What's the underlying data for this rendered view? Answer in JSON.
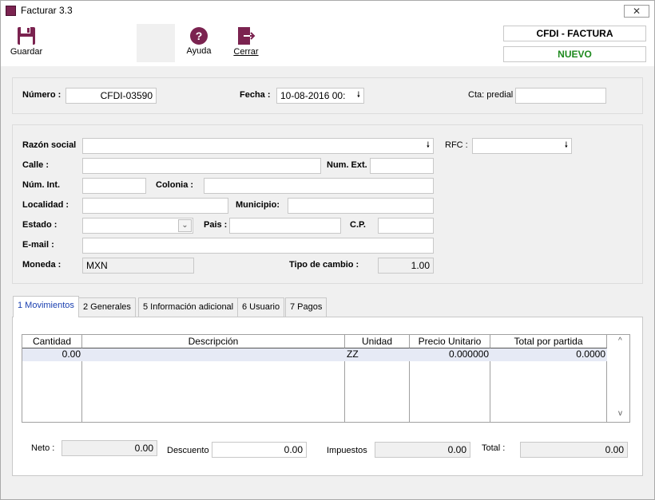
{
  "window": {
    "title": "Facturar 3.3",
    "close_glyph": "✕"
  },
  "toolbar": {
    "guardar_label": "Guardar",
    "ayuda_label": "Ayuda",
    "cerrar_label": "Cerrar",
    "ayuda_glyph": "?",
    "doc_type": "CFDI - FACTURA",
    "status": "NUEVO",
    "status_color": "#1e8a1e"
  },
  "header": {
    "numero_label": "Número :",
    "numero_value": "CFDI-03590",
    "fecha_label": "Fecha :",
    "fecha_value": "10-08-2016 00:",
    "cta_label": "Cta: predial :",
    "cta_value": ""
  },
  "cliente": {
    "razon_label": "Razón social",
    "razon_value": "",
    "rfc_label": "RFC :",
    "rfc_value": "",
    "calle_label": "Calle :",
    "calle_value": "",
    "numext_label": "Num. Ext.",
    "numext_value": "",
    "numint_label": "Núm. Int.",
    "numint_value": "",
    "colonia_label": "Colonia :",
    "colonia_value": "",
    "localidad_label": "Localidad :",
    "localidad_value": "",
    "municipio_label": "Municipio:",
    "municipio_value": "",
    "estado_label": "Estado :",
    "estado_value": "",
    "pais_label": "Pais :",
    "pais_value": "",
    "cp_label": "C.P.",
    "cp_value": "",
    "email_label": "E-mail :",
    "email_value": "",
    "moneda_label": "Moneda :",
    "moneda_value": "MXN",
    "tipocambio_label": "Tipo de cambio :",
    "tipocambio_value": "1.00"
  },
  "tabs": [
    {
      "label": "1 Movimientos"
    },
    {
      "label": "2 Generales"
    },
    {
      "label": "5 Información adicional"
    },
    {
      "label": "6 Usuario"
    },
    {
      "label": "7 Pagos"
    }
  ],
  "grid": {
    "columns": [
      "Cantidad",
      "Descripción",
      "Unidad",
      "Precio Unitario",
      "Total por partida"
    ],
    "rows": [
      {
        "cantidad": "0.00",
        "descripcion": "",
        "unidad": "ZZ",
        "precio": "0.000000",
        "total": "0.0000"
      }
    ]
  },
  "totals": {
    "neto_label": "Neto :",
    "neto_value": "0.00",
    "descuento_label": "Descuento",
    "descuento_value": "0.00",
    "impuestos_label": "Impuestos",
    "impuestos_value": "0.00",
    "total_label": "Total :",
    "total_value": "0.00"
  },
  "icons": {
    "dropdown_arrow": "🠗",
    "combo_chevron": "⌄",
    "scroll_up": "^",
    "scroll_down": "v"
  },
  "colors": {
    "accent": "#7b2350",
    "active_tab_text": "#1a3fb0"
  }
}
